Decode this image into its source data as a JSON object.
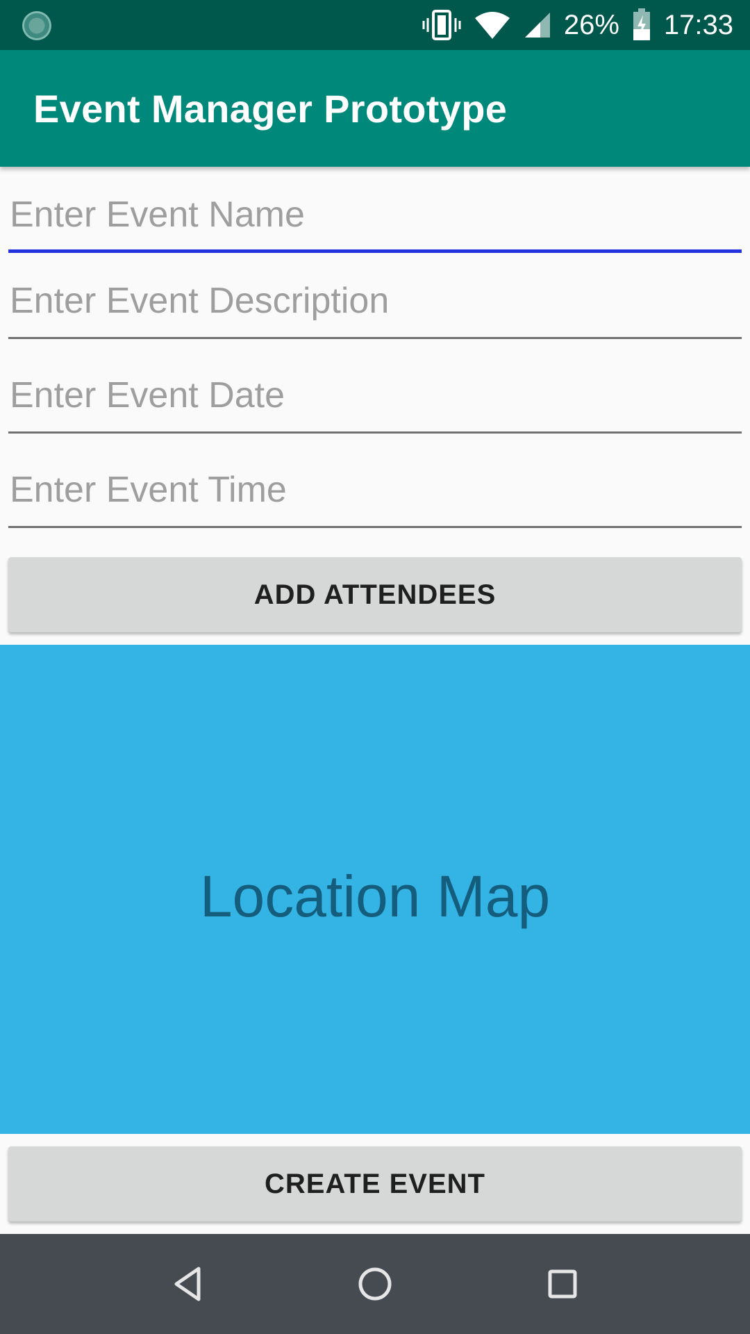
{
  "status_bar": {
    "battery": "26%",
    "time": "17:33",
    "icons": [
      "sync-icon",
      "vibrate-icon",
      "wifi-icon",
      "signal-icon",
      "battery-charging-icon"
    ]
  },
  "app_bar": {
    "title": "Event Manager Prototype"
  },
  "form": {
    "event_name": {
      "value": "",
      "placeholder": "Enter Event Name"
    },
    "event_description": {
      "value": "",
      "placeholder": "Enter Event Description"
    },
    "event_date": {
      "value": "",
      "placeholder": "Enter Event Date"
    },
    "event_time": {
      "value": "",
      "placeholder": "Enter Event Time"
    }
  },
  "buttons": {
    "add_attendees": "ADD ATTENDEES",
    "create_event": "CREATE EVENT"
  },
  "map": {
    "label": "Location Map"
  },
  "nav_bar": {
    "icons": [
      "back-icon",
      "home-icon",
      "recents-icon"
    ]
  },
  "colors": {
    "status_bar": "#00574b",
    "app_bar": "#00897b",
    "map": "#34b4e5",
    "focus_underline": "#2233dd",
    "nav_bar": "#464b52"
  }
}
